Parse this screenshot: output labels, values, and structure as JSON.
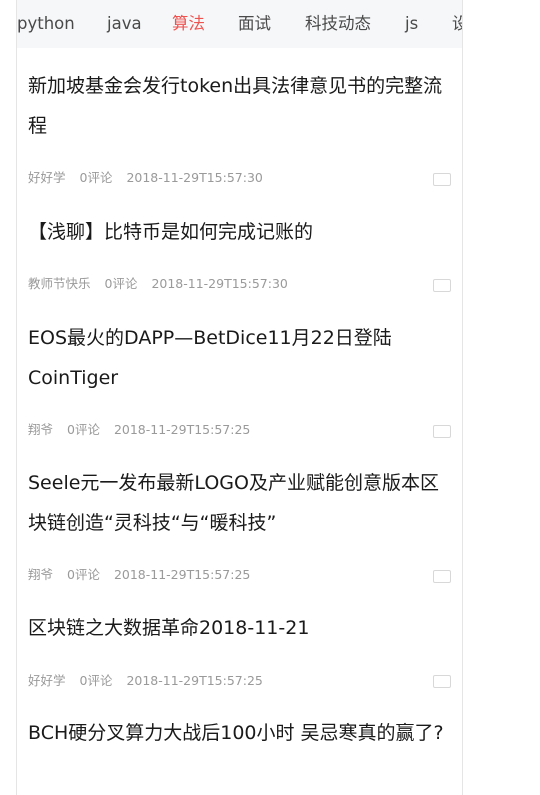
{
  "tabs": [
    {
      "label": "python"
    },
    {
      "label": "java"
    },
    {
      "label": "算法"
    },
    {
      "label": "面试"
    },
    {
      "label": "科技动态"
    },
    {
      "label": "js"
    },
    {
      "label": "设"
    }
  ],
  "active_tab": "算法",
  "colors": {
    "accent": "#ef5350",
    "title": "#1a1a1a",
    "meta": "#9a9a9a",
    "tabbar_bg": "#f6f7f9"
  },
  "articles": [
    {
      "title": "新加坡基金会发行token出具法律意见书的完整流程",
      "author": "好好学",
      "comments": "0评论",
      "time": "2018-11-29T15:57:30"
    },
    {
      "title": "【浅聊】比特币是如何完成记账的",
      "author": "教师节快乐",
      "comments": "0评论",
      "time": "2018-11-29T15:57:30"
    },
    {
      "title": "EOS最火的DAPP—BetDice11月22日登陆CoinTiger",
      "author": "翔爷",
      "comments": "0评论",
      "time": "2018-11-29T15:57:25"
    },
    {
      "title": "Seele元一发布最新LOGO及产业赋能创意版本区块链创造“灵科技“与“暖科技”",
      "author": "翔爷",
      "comments": "0评论",
      "time": "2018-11-29T15:57:25"
    },
    {
      "title": "区块链之大数据革命2018-11-21",
      "author": "好好学",
      "comments": "0评论",
      "time": "2018-11-29T15:57:25"
    },
    {
      "title": "BCH硬分叉算力大战后100小时 吴忌寒真的赢了?",
      "author": "",
      "comments": "",
      "time": ""
    }
  ]
}
